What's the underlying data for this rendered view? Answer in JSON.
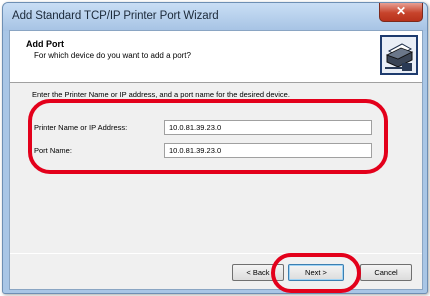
{
  "window": {
    "title": "Add Standard TCP/IP Printer Port Wizard",
    "close_label": "✕"
  },
  "header": {
    "title": "Add Port",
    "subtitle": "For which device do you want to add a port?",
    "icon": "printer-network-icon"
  },
  "form": {
    "instruction": "Enter the Printer Name or IP address, and a port name for the desired device.",
    "printer_label": "Printer Name or IP Address:",
    "printer_value": "10.0.81.39.23.0",
    "port_label": "Port Name:",
    "port_value": "10.0.81.39.23.0"
  },
  "buttons": {
    "back": "< Back",
    "next": "Next >",
    "cancel": "Cancel"
  },
  "colors": {
    "highlight": "#e3001b"
  }
}
